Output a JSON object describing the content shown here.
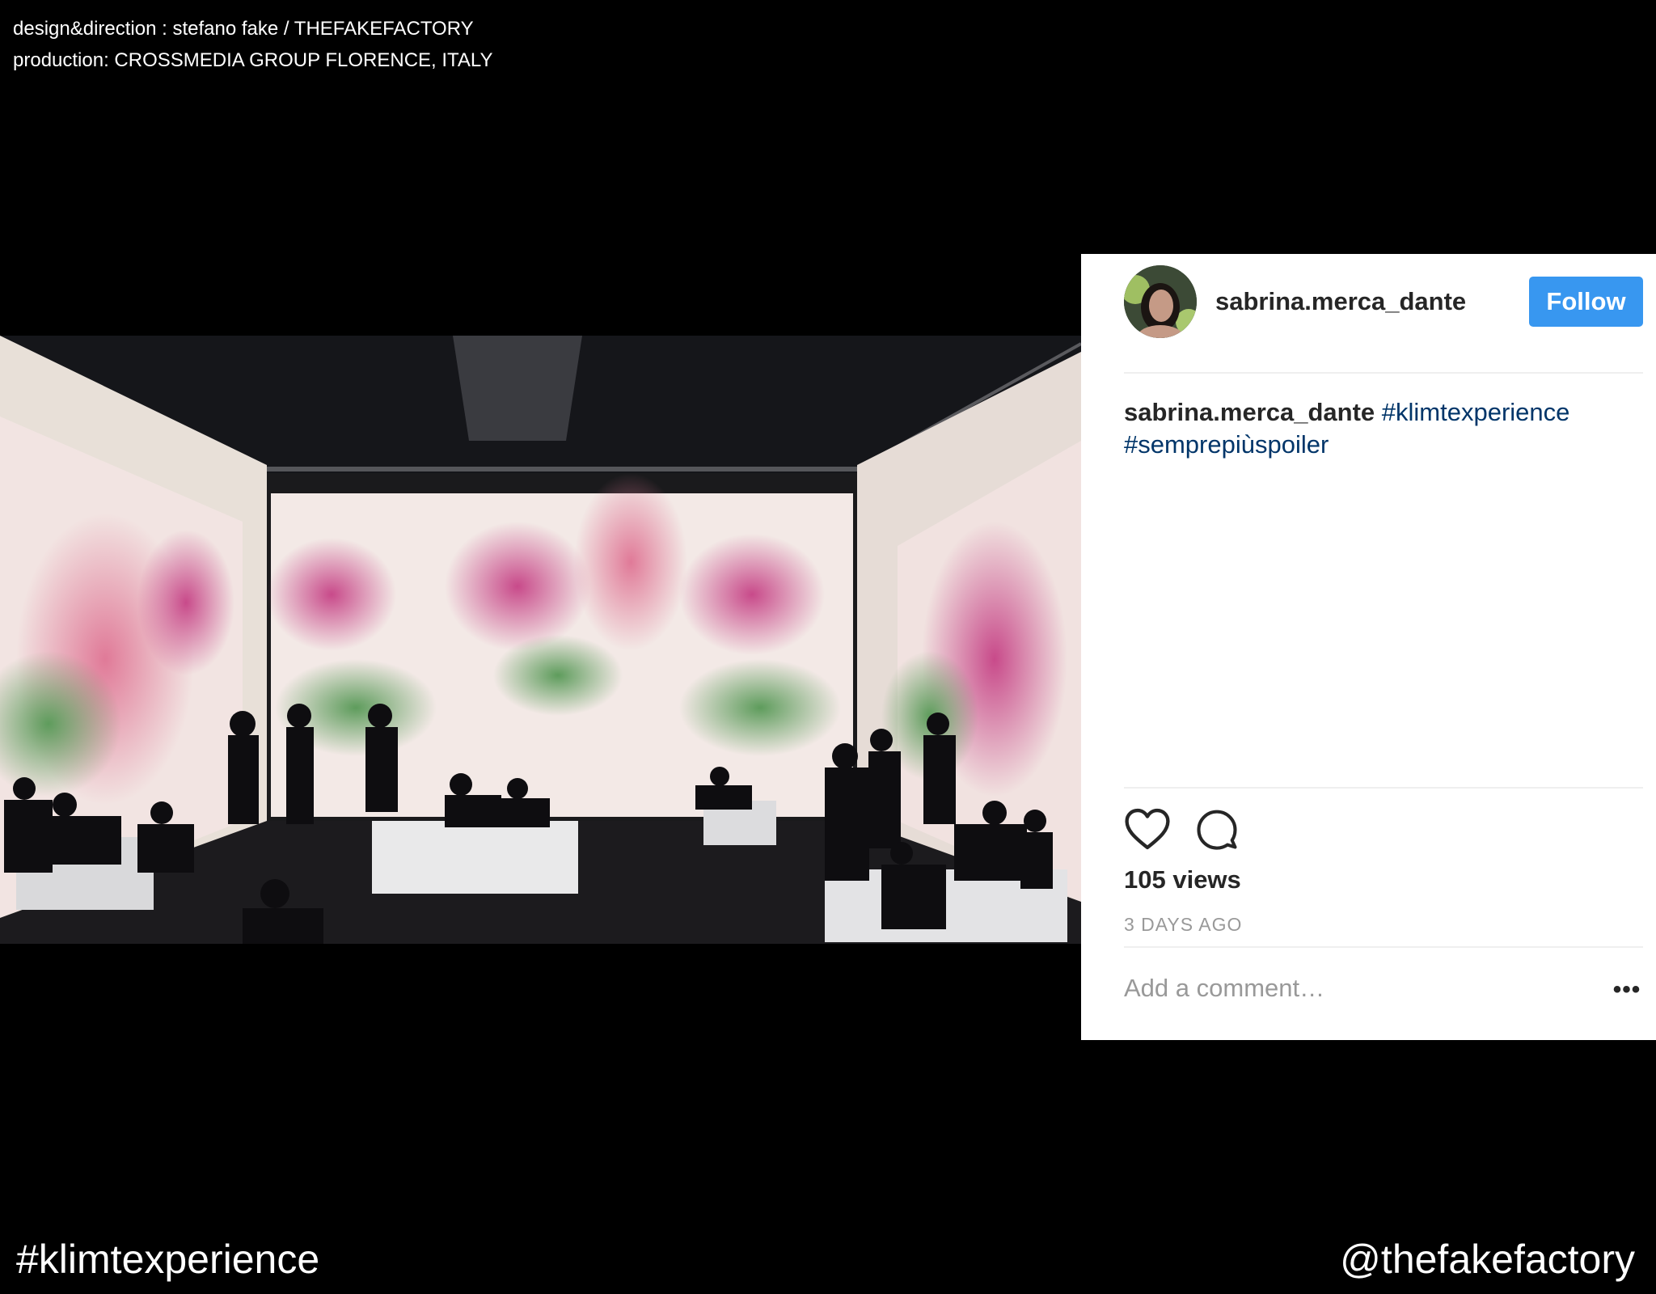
{
  "credits": {
    "line1": "design&direction : stefano fake / THEFAKEFACTORY",
    "line2": "production: CROSSMEDIA GROUP FLORENCE, ITALY"
  },
  "post": {
    "username": "sabrina.merca_dante",
    "follow_label": "Follow",
    "caption_user": "sabrina.merca_dante",
    "caption_tags": [
      "#klimtexperience",
      "#semprepiùspoiler"
    ],
    "views": "105 views",
    "timestamp": "3 DAYS AGO",
    "comment_placeholder": "Add a comment…",
    "more_label": "•••",
    "icons": [
      "heart-icon",
      "comment-icon",
      "more-options-icon"
    ]
  },
  "footer": {
    "hashtag": "#klimtexperience",
    "handle": "@thefakefactory"
  },
  "colors": {
    "background": "#000000",
    "follow_button": "#3897f0",
    "hashtag_link": "#003569",
    "secondary_text": "#999999"
  }
}
